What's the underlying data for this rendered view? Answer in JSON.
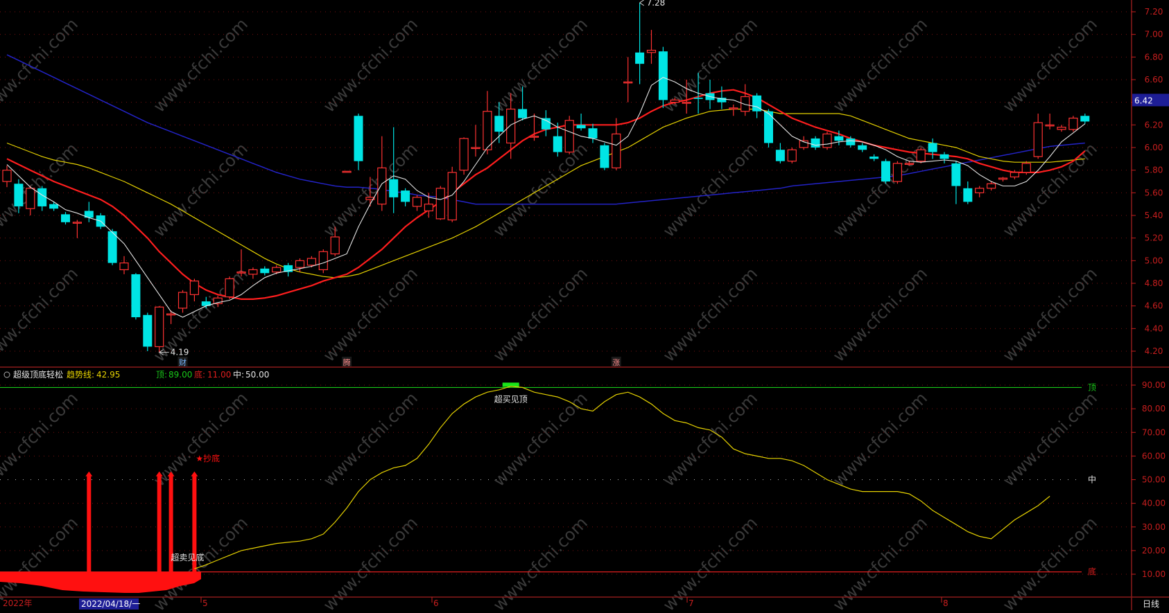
{
  "colors": {
    "background": "#000000",
    "frame": "#8b1a1a",
    "grid": "#7a1010",
    "up": "#ff3232",
    "down": "#00e5e5",
    "ma5": "#e6e6e6",
    "ma10": "#ff1e1e",
    "ma20": "#e6d200",
    "ma60": "#2323c8",
    "axis_text": "#c81e1e",
    "indicator_line": "#e6d200",
    "top_line": "#19c819",
    "bottom_line": "#e01e1e",
    "bars": "#ff1010"
  },
  "watermark": "www.cfchi.com",
  "price_panel": {
    "price_ticks": [
      "7.20",
      "7.00",
      "6.80",
      "6.60",
      "6.40",
      "6.20",
      "6.00",
      "5.80",
      "5.60",
      "5.40",
      "5.20",
      "5.00",
      "4.80",
      "4.60",
      "4.40",
      "4.20"
    ],
    "last_price_label": "6.42",
    "high_marker": "7.28",
    "low_marker": "4.19",
    "event_badges": [
      "财",
      "腾",
      "涨"
    ]
  },
  "indicator_panel": {
    "name": "超级顶底轻松",
    "trend_label": "趋势线:",
    "trend_value": "42.95",
    "top_label": "顶:",
    "top_value": "89.00",
    "bottom_label": "底:",
    "bottom_value": "11.00",
    "mid_label": "中:",
    "mid_value": "50.00",
    "ticks": [
      "90.00",
      "80.00",
      "70.00",
      "60.00",
      "50.00",
      "40.00",
      "30.00",
      "20.00",
      "10.00"
    ],
    "top_tag": "顶",
    "mid_tag": "中",
    "bottom_tag": "底",
    "overbought_text": "超买见顶",
    "oversold_text": "超卖见底",
    "bottom_buy_text": "★抄底"
  },
  "time_axis": {
    "year_label": "2022年",
    "cursor_date": "2022/04/18/一",
    "months": [
      "5",
      "6",
      "7",
      "8"
    ],
    "period": "日线"
  },
  "chart_data": [
    {
      "type": "candlestick",
      "title": "",
      "ylim": [
        4.1,
        7.3
      ],
      "candles": [
        [
          5.7,
          5.8,
          5.65,
          5.84
        ],
        [
          5.68,
          5.48,
          5.42,
          5.72
        ],
        [
          5.46,
          5.64,
          5.4,
          5.66
        ],
        [
          5.64,
          5.48,
          5.44,
          5.66
        ],
        [
          5.5,
          5.46,
          5.44,
          5.52
        ],
        [
          5.41,
          5.34,
          5.32,
          5.43
        ],
        [
          5.34,
          5.34,
          5.2,
          5.36
        ],
        [
          5.44,
          5.38,
          5.34,
          5.52
        ],
        [
          5.4,
          5.3,
          5.28,
          5.42
        ],
        [
          5.26,
          4.98,
          4.96,
          5.28
        ],
        [
          4.92,
          4.98,
          4.88,
          5.04
        ],
        [
          4.88,
          4.5,
          4.48,
          4.89
        ],
        [
          4.52,
          4.24,
          4.2,
          4.54
        ],
        [
          4.24,
          4.59,
          4.19,
          4.6
        ],
        [
          4.52,
          4.53,
          4.44,
          4.56
        ],
        [
          4.58,
          4.72,
          4.54,
          4.74
        ],
        [
          4.7,
          4.82,
          4.64,
          4.84
        ],
        [
          4.64,
          4.6,
          4.58,
          4.68
        ],
        [
          4.62,
          4.67,
          4.59,
          4.69
        ],
        [
          4.68,
          4.84,
          4.66,
          4.86
        ],
        [
          4.9,
          4.9,
          4.86,
          5.1
        ],
        [
          4.88,
          4.92,
          4.84,
          4.94
        ],
        [
          4.93,
          4.89,
          4.87,
          4.95
        ],
        [
          4.9,
          4.94,
          4.88,
          4.96
        ],
        [
          4.96,
          4.9,
          4.86,
          4.98
        ],
        [
          4.94,
          5.0,
          4.9,
          5.02
        ],
        [
          4.96,
          5.02,
          4.94,
          5.04
        ],
        [
          4.92,
          5.08,
          4.89,
          5.1
        ],
        [
          5.06,
          5.21,
          5.04,
          5.3
        ],
        [
          5.79,
          5.79,
          5.79,
          5.79
        ],
        [
          6.28,
          5.88,
          5.8,
          6.3
        ],
        [
          5.54,
          5.56,
          5.48,
          5.74
        ],
        [
          5.5,
          5.82,
          5.44,
          6.1
        ],
        [
          5.72,
          5.56,
          5.42,
          6.18
        ],
        [
          5.62,
          5.52,
          5.48,
          5.64
        ],
        [
          5.48,
          5.56,
          5.44,
          5.58
        ],
        [
          5.44,
          5.5,
          5.38,
          5.6
        ],
        [
          5.37,
          5.64,
          5.36,
          5.66
        ],
        [
          5.36,
          5.78,
          5.34,
          5.83
        ],
        [
          5.8,
          6.08,
          5.76,
          6.09
        ],
        [
          6.0,
          6.0,
          5.92,
          6.2
        ],
        [
          5.98,
          6.32,
          5.94,
          6.5
        ],
        [
          6.28,
          6.14,
          6.04,
          6.4
        ],
        [
          6.04,
          6.34,
          5.9,
          6.48
        ],
        [
          6.34,
          6.26,
          6.24,
          6.54
        ],
        [
          6.1,
          6.1,
          6.06,
          6.3
        ],
        [
          6.26,
          6.16,
          6.1,
          6.33
        ],
        [
          6.1,
          5.96,
          5.92,
          6.22
        ],
        [
          5.96,
          6.24,
          5.94,
          6.28
        ],
        [
          6.2,
          6.17,
          6.15,
          6.3
        ],
        [
          6.17,
          6.08,
          6.04,
          6.21
        ],
        [
          6.02,
          5.82,
          5.8,
          6.04
        ],
        [
          5.82,
          6.12,
          5.8,
          6.26
        ],
        [
          6.58,
          6.58,
          6.4,
          6.8
        ],
        [
          6.84,
          6.74,
          6.56,
          7.28
        ],
        [
          6.84,
          6.86,
          6.74,
          7.04
        ],
        [
          6.85,
          6.42,
          6.35,
          6.89
        ],
        [
          6.4,
          6.42,
          6.38,
          6.44
        ],
        [
          6.4,
          6.4,
          6.3,
          6.6
        ],
        [
          6.44,
          6.43,
          6.3,
          6.66
        ],
        [
          6.48,
          6.42,
          6.34,
          6.6
        ],
        [
          6.44,
          6.4,
          6.34,
          6.54
        ],
        [
          6.35,
          6.35,
          6.28,
          6.38
        ],
        [
          6.32,
          6.45,
          6.28,
          6.56
        ],
        [
          6.46,
          6.32,
          6.26,
          6.48
        ],
        [
          6.32,
          6.04,
          6.0,
          6.34
        ],
        [
          5.98,
          5.88,
          5.86,
          6.04
        ],
        [
          5.88,
          5.98,
          5.86,
          6.0
        ],
        [
          6.0,
          6.06,
          5.98,
          6.1
        ],
        [
          6.08,
          6.0,
          5.98,
          6.1
        ],
        [
          6.0,
          6.12,
          5.98,
          6.14
        ],
        [
          6.1,
          6.06,
          6.02,
          6.15
        ],
        [
          6.08,
          6.02,
          6.0,
          6.1
        ],
        [
          6.02,
          5.98,
          5.96,
          6.04
        ],
        [
          5.92,
          5.9,
          5.88,
          5.94
        ],
        [
          5.88,
          5.7,
          5.68,
          5.9
        ],
        [
          5.7,
          5.86,
          5.68,
          5.88
        ],
        [
          5.86,
          5.86,
          5.84,
          5.88
        ],
        [
          5.88,
          5.98,
          5.86,
          6.0
        ],
        [
          6.04,
          5.96,
          5.9,
          6.08
        ],
        [
          5.94,
          5.9,
          5.86,
          5.96
        ],
        [
          5.86,
          5.66,
          5.5,
          5.88
        ],
        [
          5.64,
          5.52,
          5.5,
          5.7
        ],
        [
          5.6,
          5.64,
          5.56,
          5.66
        ],
        [
          5.64,
          5.68,
          5.62,
          5.7
        ],
        [
          5.72,
          5.73,
          5.7,
          5.74
        ],
        [
          5.74,
          5.78,
          5.72,
          5.8
        ],
        [
          5.78,
          5.86,
          5.76,
          5.88
        ],
        [
          5.92,
          6.22,
          5.9,
          6.3
        ],
        [
          6.2,
          6.2,
          6.16,
          6.3
        ],
        [
          6.16,
          6.18,
          6.14,
          6.2
        ],
        [
          6.16,
          6.26,
          6.14,
          6.28
        ],
        [
          6.28,
          6.23,
          6.21,
          6.3
        ]
      ],
      "ma5": [
        5.85,
        5.75,
        5.65,
        5.58,
        5.52,
        5.45,
        5.42,
        5.38,
        5.35,
        5.25,
        5.15,
        5.0,
        4.85,
        4.7,
        4.55,
        4.5,
        4.55,
        4.6,
        4.63,
        4.65,
        4.7,
        4.78,
        4.85,
        4.89,
        4.91,
        4.93,
        4.95,
        4.98,
        5.02,
        5.06,
        5.3,
        5.5,
        5.68,
        5.75,
        5.72,
        5.62,
        5.56,
        5.54,
        5.58,
        5.7,
        5.85,
        6.0,
        6.1,
        6.2,
        6.25,
        6.28,
        6.24,
        6.18,
        6.14,
        6.1,
        6.08,
        6.05,
        6.02,
        6.1,
        6.3,
        6.55,
        6.62,
        6.58,
        6.52,
        6.48,
        6.45,
        6.43,
        6.42,
        6.38,
        6.36,
        6.3,
        6.2,
        6.1,
        6.05,
        6.02,
        6.03,
        6.05,
        6.06,
        6.05,
        6.02,
        5.98,
        5.92,
        5.88,
        5.87,
        5.88,
        5.89,
        5.88,
        5.84,
        5.76,
        5.7,
        5.66,
        5.66,
        5.7,
        5.8,
        5.92,
        6.05,
        6.13,
        6.21
      ],
      "ma10": [
        5.9,
        5.85,
        5.8,
        5.75,
        5.7,
        5.66,
        5.62,
        5.58,
        5.54,
        5.48,
        5.4,
        5.3,
        5.2,
        5.08,
        4.98,
        4.88,
        4.8,
        4.74,
        4.7,
        4.68,
        4.66,
        4.66,
        4.67,
        4.69,
        4.72,
        4.75,
        4.78,
        4.82,
        4.85,
        4.88,
        4.94,
        5.02,
        5.1,
        5.2,
        5.3,
        5.38,
        5.45,
        5.52,
        5.6,
        5.68,
        5.76,
        5.82,
        5.9,
        5.98,
        6.06,
        6.12,
        6.16,
        6.18,
        6.2,
        6.2,
        6.2,
        6.2,
        6.2,
        6.22,
        6.26,
        6.32,
        6.37,
        6.4,
        6.42,
        6.45,
        6.48,
        6.5,
        6.51,
        6.48,
        6.44,
        6.38,
        6.32,
        6.26,
        6.22,
        6.18,
        6.15,
        6.12,
        6.08,
        6.05,
        6.02,
        6.0,
        5.98,
        5.96,
        5.95,
        5.94,
        5.93,
        5.92,
        5.9,
        5.86,
        5.83,
        5.8,
        5.78,
        5.78,
        5.78,
        5.8,
        5.83,
        5.88,
        5.97
      ],
      "ma20": [
        6.04,
        6.0,
        5.96,
        5.92,
        5.89,
        5.87,
        5.85,
        5.82,
        5.78,
        5.74,
        5.7,
        5.65,
        5.6,
        5.55,
        5.5,
        5.44,
        5.38,
        5.32,
        5.26,
        5.2,
        5.14,
        5.08,
        5.02,
        4.97,
        4.93,
        4.9,
        4.88,
        4.86,
        4.85,
        4.86,
        4.88,
        4.92,
        4.96,
        5.0,
        5.04,
        5.08,
        5.12,
        5.16,
        5.2,
        5.25,
        5.3,
        5.36,
        5.42,
        5.48,
        5.54,
        5.6,
        5.66,
        5.72,
        5.78,
        5.84,
        5.88,
        5.92,
        5.96,
        6.0,
        6.06,
        6.12,
        6.18,
        6.22,
        6.26,
        6.29,
        6.32,
        6.33,
        6.34,
        6.34,
        6.34,
        6.32,
        6.3,
        6.3,
        6.3,
        6.3,
        6.3,
        6.3,
        6.28,
        6.24,
        6.2,
        6.16,
        6.12,
        6.08,
        6.06,
        6.04,
        6.02,
        6.0,
        5.96,
        5.92,
        5.9,
        5.88,
        5.87,
        5.87,
        5.87,
        5.87,
        5.88,
        5.89,
        5.9
      ],
      "ma60": [
        6.82,
        6.77,
        6.72,
        6.67,
        6.62,
        6.57,
        6.52,
        6.47,
        6.42,
        6.37,
        6.32,
        6.27,
        6.22,
        6.18,
        6.14,
        6.1,
        6.06,
        6.02,
        5.98,
        5.94,
        5.9,
        5.86,
        5.82,
        5.78,
        5.75,
        5.72,
        5.7,
        5.68,
        5.66,
        5.65,
        5.65,
        5.64,
        5.63,
        5.61,
        5.6,
        5.58,
        5.57,
        5.56,
        5.54,
        5.52,
        5.5,
        5.5,
        5.5,
        5.5,
        5.5,
        5.5,
        5.5,
        5.5,
        5.5,
        5.5,
        5.5,
        5.5,
        5.5,
        5.51,
        5.52,
        5.53,
        5.54,
        5.55,
        5.56,
        5.57,
        5.58,
        5.59,
        5.6,
        5.61,
        5.62,
        5.63,
        5.64,
        5.66,
        5.67,
        5.68,
        5.69,
        5.7,
        5.71,
        5.72,
        5.73,
        5.74,
        5.75,
        5.77,
        5.79,
        5.81,
        5.83,
        5.85,
        5.87,
        5.89,
        5.91,
        5.93,
        5.95,
        5.97,
        5.99,
        6.01,
        6.02,
        6.03,
        6.04
      ]
    },
    {
      "type": "line",
      "title": "超级顶底轻松",
      "ylim": [
        0,
        95
      ],
      "top": 89.0,
      "mid": 50.0,
      "bottom": 11.0,
      "trend_line_start_index": 16,
      "trend_line": [
        12.3,
        14,
        16,
        18,
        20,
        21,
        22,
        23,
        23.5,
        24,
        25,
        27,
        32,
        38,
        45,
        50,
        53,
        55,
        56,
        59,
        65,
        72,
        78,
        82,
        85,
        87,
        88,
        89.5,
        89,
        87,
        86,
        85,
        83,
        80,
        79,
        83,
        86,
        87,
        85,
        82,
        78,
        75,
        74,
        72,
        71,
        68,
        63,
        61,
        60,
        59,
        59,
        58,
        56,
        53,
        50,
        48,
        46,
        45,
        45,
        45,
        45,
        44,
        41,
        37,
        34,
        31,
        28,
        26,
        25,
        29,
        33,
        36,
        39,
        43
      ],
      "oversold_bar_indices": [
        7,
        13,
        14,
        16
      ]
    }
  ]
}
